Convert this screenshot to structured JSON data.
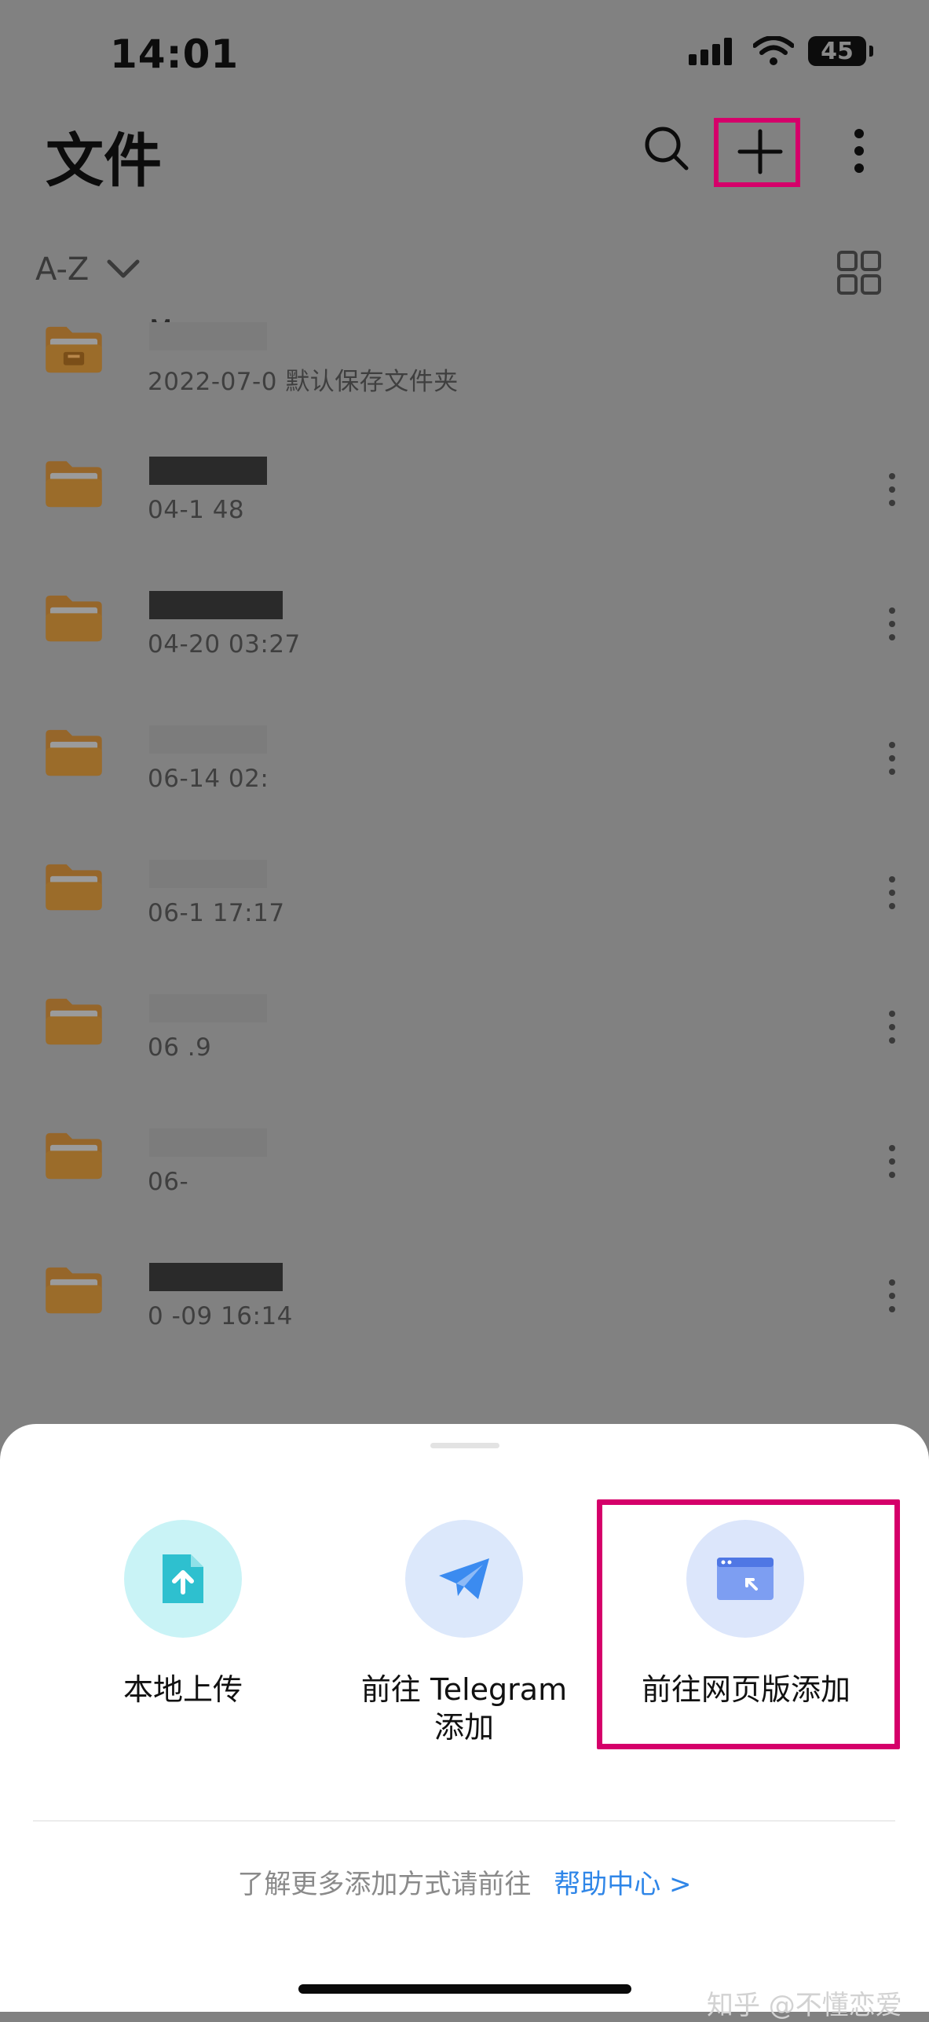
{
  "status_bar": {
    "time": "14:01",
    "battery": "45"
  },
  "header": {
    "title": "文件"
  },
  "sort": {
    "label": "A-Z"
  },
  "files": [
    {
      "name": "M",
      "meta": "2022-07-0",
      "note": "默认保存文件夹"
    },
    {
      "name": "",
      "meta": "04-1",
      "meta_tail": "48"
    },
    {
      "name": "",
      "meta": "04-20 03:27"
    },
    {
      "name": "",
      "meta": "06-14 02:"
    },
    {
      "name": "",
      "meta": "06-1",
      "meta_tail": "17:17"
    },
    {
      "name": "",
      "meta": "06",
      "meta_tail": ".9"
    },
    {
      "name": "",
      "meta": "06-"
    },
    {
      "name": "",
      "meta": "0 -09 16:14"
    }
  ],
  "sheet": {
    "options": [
      {
        "label": "本地上传"
      },
      {
        "label": "前往 Telegram\n添加"
      },
      {
        "label": "前往网页版添加"
      }
    ],
    "help_text": "了解更多添加方式请前往",
    "help_link": "帮助中心 >"
  },
  "watermark": "知乎 @不懂恋爱",
  "colors": {
    "highlight": "#d5006a",
    "link": "#2f86e8",
    "folder": "#9b6c2a"
  }
}
